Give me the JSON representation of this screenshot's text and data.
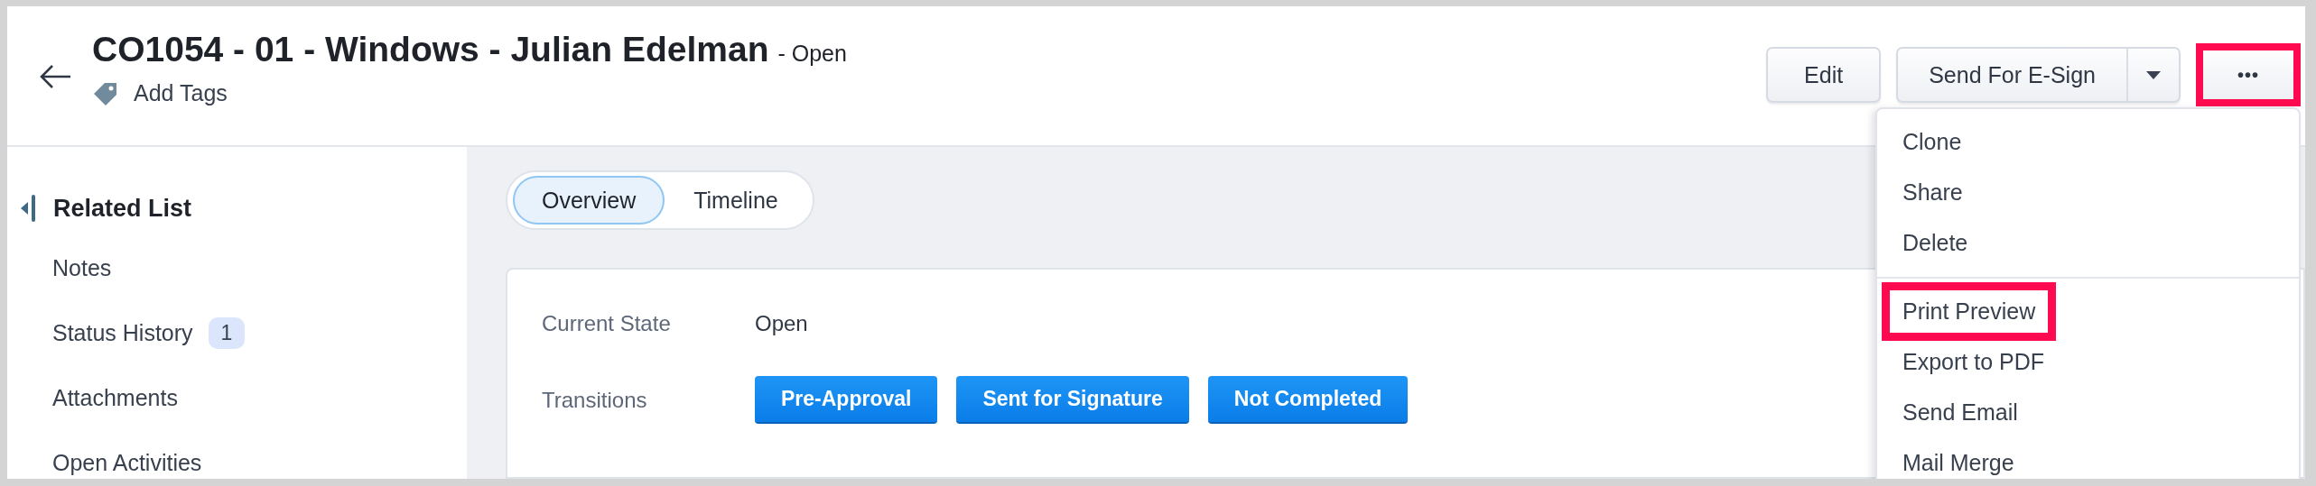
{
  "header": {
    "title": "CO1054 - 01 - Windows - Julian Edelman",
    "status": "- Open",
    "tags_label": "Add Tags"
  },
  "actions": {
    "edit": "Edit",
    "send": "Send For E-Sign",
    "more": "•••",
    "more_highlighted": true
  },
  "menu": {
    "groups": [
      [
        {
          "label": "Clone",
          "highlighted": false
        },
        {
          "label": "Share",
          "highlighted": false
        },
        {
          "label": "Delete",
          "highlighted": false
        }
      ],
      [
        {
          "label": "Print Preview",
          "highlighted": true
        },
        {
          "label": "Export to PDF",
          "highlighted": false
        },
        {
          "label": "Send Email",
          "highlighted": false
        },
        {
          "label": "Mail Merge",
          "highlighted": false
        }
      ]
    ]
  },
  "sidebar": {
    "title": "Related List",
    "items": [
      {
        "label": "Notes"
      },
      {
        "label": "Status History",
        "count": "1"
      },
      {
        "label": "Attachments"
      },
      {
        "label": "Open Activities"
      }
    ]
  },
  "tabs": [
    {
      "label": "Overview",
      "selected": true
    },
    {
      "label": "Timeline",
      "selected": false
    }
  ],
  "details": {
    "current_state_label": "Current State",
    "current_state": "Open",
    "transitions_label": "Transitions",
    "transitions": [
      "Pre-Approval",
      "Sent for Signature",
      "Not Completed"
    ]
  }
}
